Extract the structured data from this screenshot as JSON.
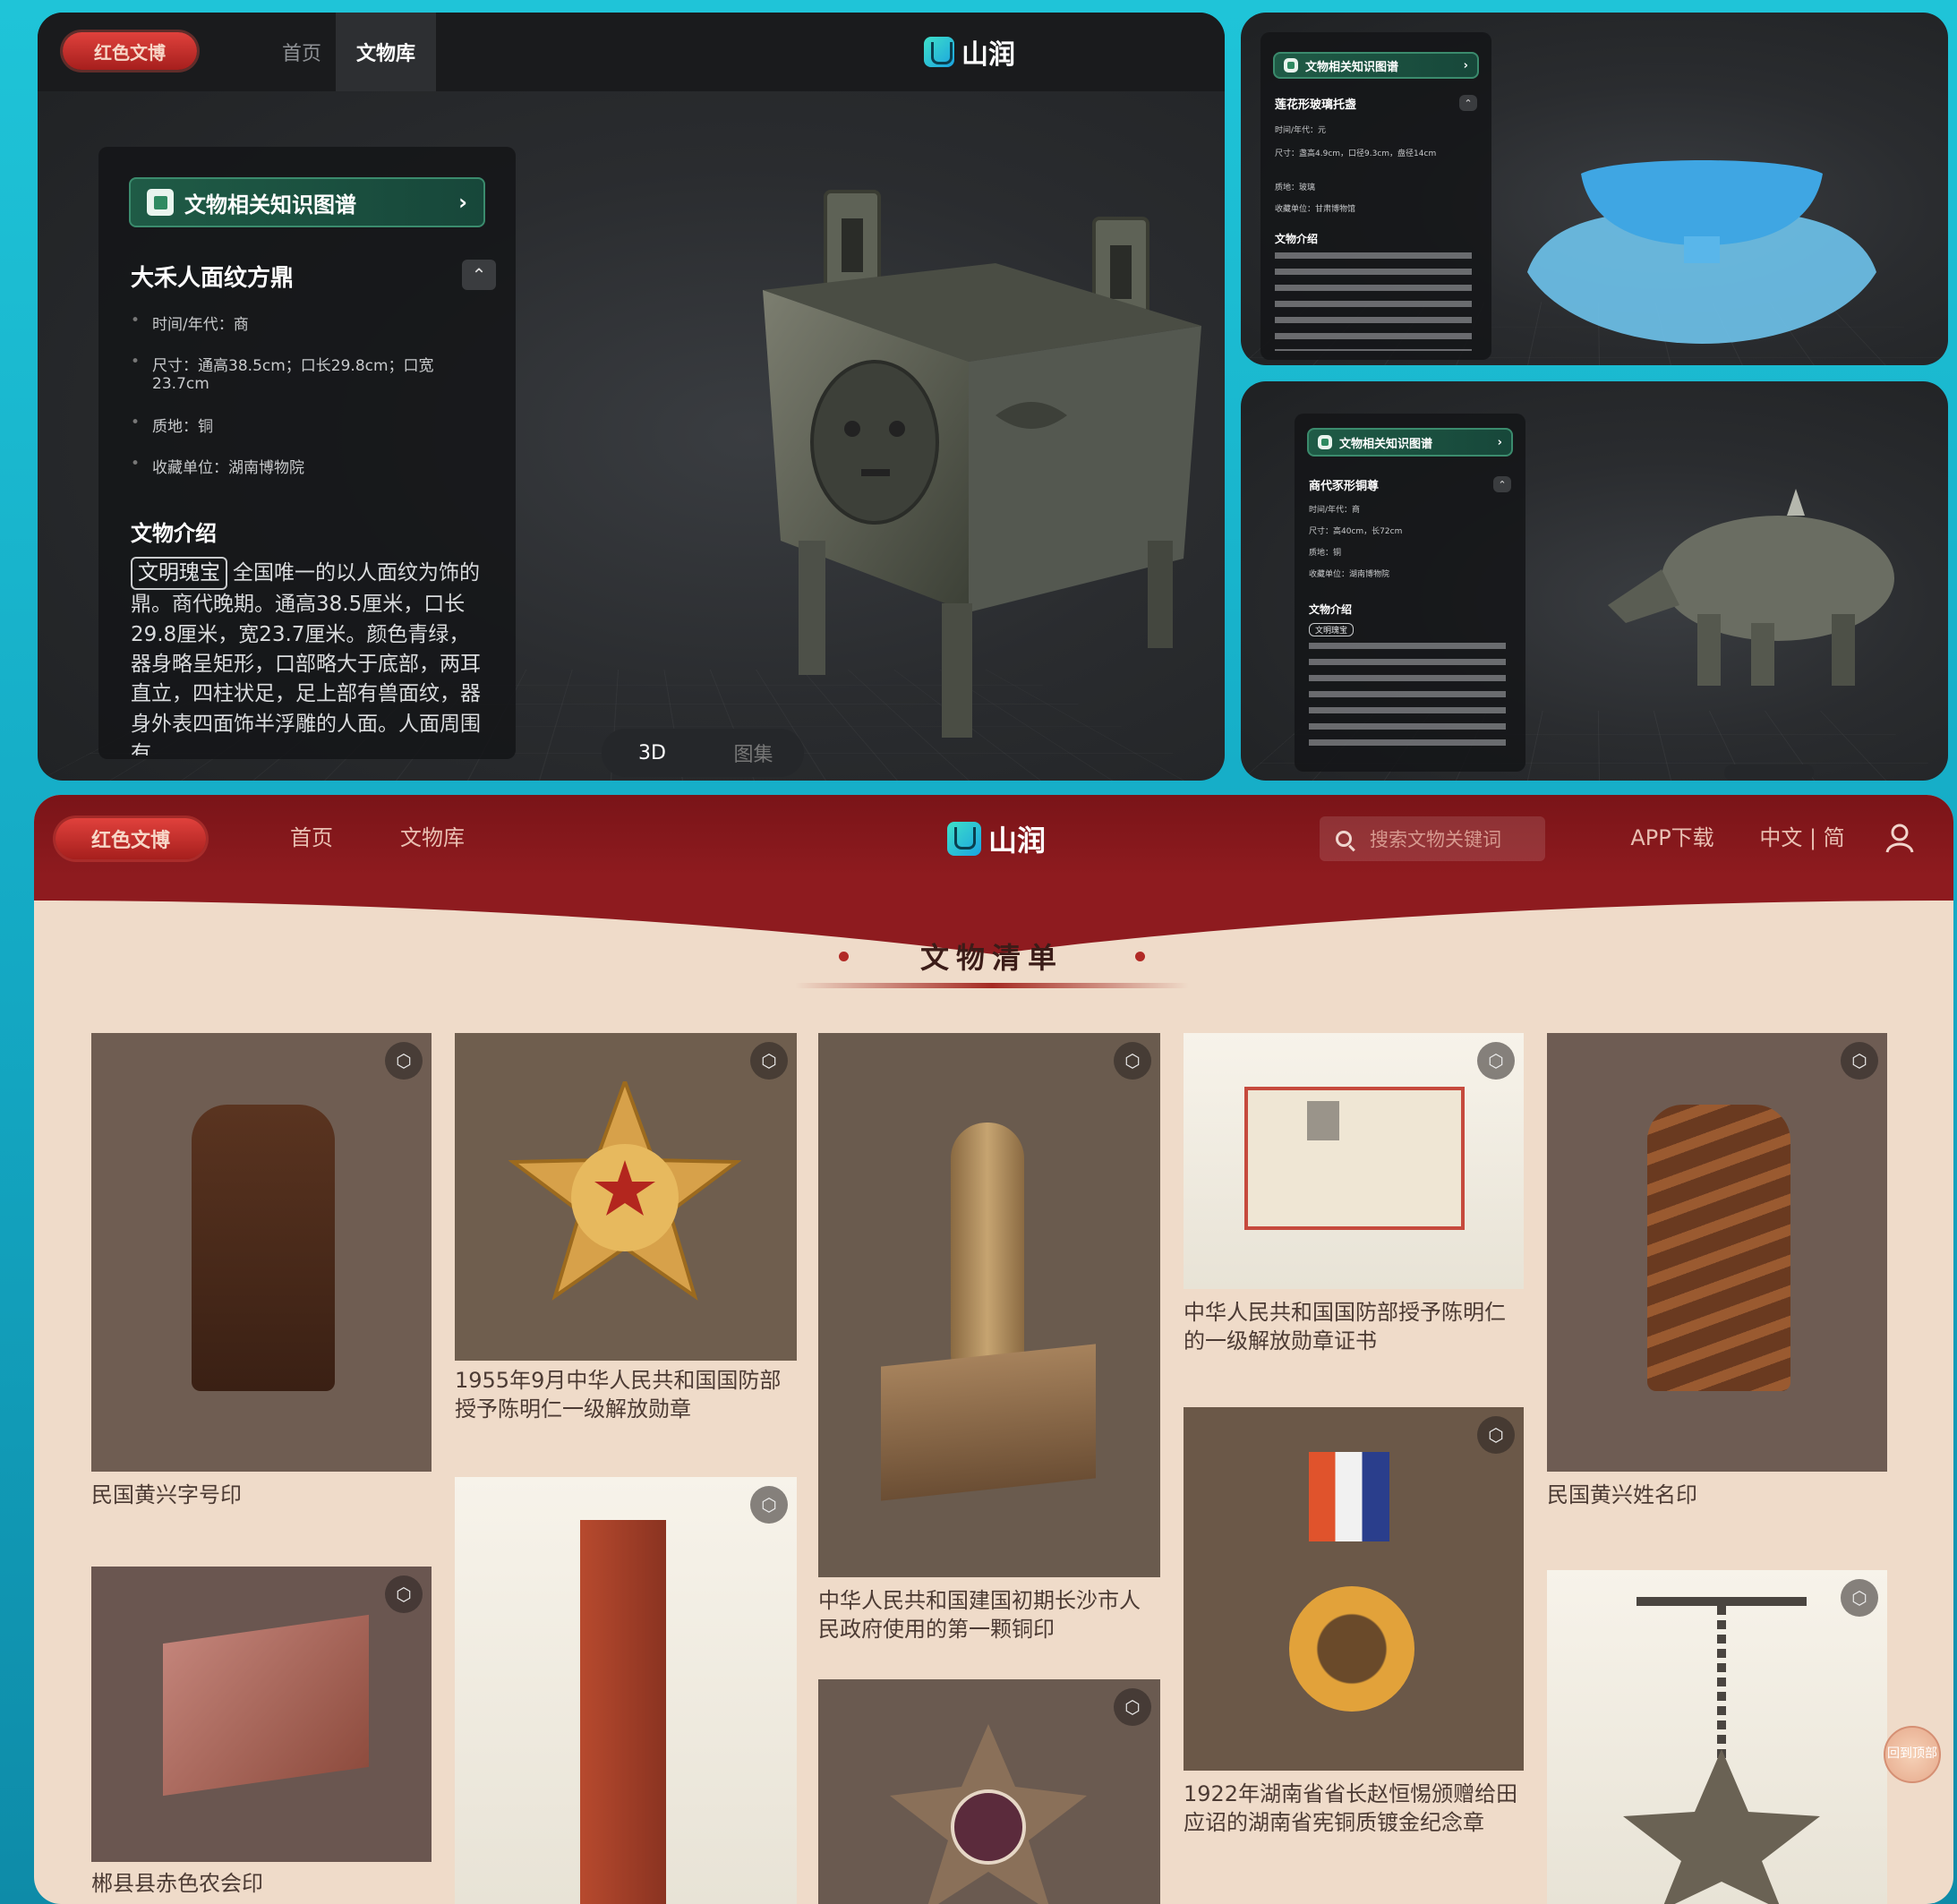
{
  "brand": {
    "pill_label": "红色文博",
    "logo_text": "山润"
  },
  "main_viewer": {
    "nav": {
      "home": "首页",
      "library": "文物库"
    },
    "card": {
      "kg_button": "文物相关知识图谱",
      "title": "大禾人面纹方鼎",
      "meta": [
        "时间/年代：商",
        "尺寸：通高38.5cm；口长29.8cm；口宽23.7cm",
        "质地：铜",
        "收藏单位：湖南博物院"
      ],
      "intro_heading": "文物介绍",
      "intro_tag": "文明瑰宝",
      "intro_text": "全国唯一的以人面纹为饰的鼎。商代晚期。通高38.5厘米，口长29.8厘米，宽23.7厘米。颜色青绿，器身略呈矩形，口部略大于底部，两耳直立，四柱状足，足上部有兽面纹，器身外表四面饰半浮雕的人面。人面周围有"
    },
    "toggle": {
      "left": "3D",
      "right": "图集"
    }
  },
  "thumb_top": {
    "kg_button": "文物相关知识图谱",
    "title": "莲花形玻璃托盏",
    "meta": [
      "时间/年代：元",
      "尺寸：盏高4.9cm，口径9.3cm，盘径14cm",
      "质地：玻璃",
      "收藏单位：甘肃博物馆"
    ],
    "intro_heading": "文物介绍"
  },
  "thumb_bottom": {
    "kg_button": "文物相关知识图谱",
    "title": "商代豕形铜尊",
    "meta": [
      "时间/年代：商",
      "尺寸：高40cm，长72cm",
      "质地：铜",
      "收藏单位：湖南博物院"
    ],
    "intro_heading": "文物介绍",
    "intro_tag": "文明瑰宝"
  },
  "catalog": {
    "nav": {
      "home": "首页",
      "library": "文物库"
    },
    "search_placeholder": "搜索文物关键词",
    "app_download": "APP下载",
    "lang": "中文 | 简",
    "section_title": "文物清单",
    "float_badge": "回到顶部",
    "items": [
      {
        "caption": "民国黄兴字号印"
      },
      {
        "caption": "1955年9月中华人民共和国国防部授予陈明仁一级解放勋章"
      },
      {
        "caption": "中华人民共和国建国初期长沙市人民政府使用的第一颗铜印"
      },
      {
        "caption": "中华人民共和国国防部授予陈明仁的一级解放勋章证书"
      },
      {
        "caption": "民国黄兴姓名印"
      },
      {
        "caption": "郴县县赤色农会印"
      },
      {
        "caption": "1922年湖南省省长赵恒惕颁赠给田应诏的湖南省宪铜质镀金纪念章"
      }
    ]
  },
  "colors": {
    "accent_red": "#8e1b1f",
    "kg_green": "#1f5b46",
    "page_bg": "#efdbc9"
  }
}
